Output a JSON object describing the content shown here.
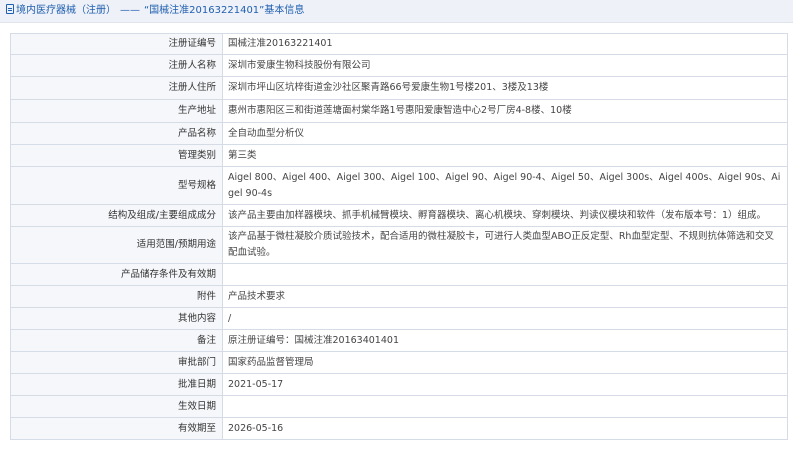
{
  "header": {
    "section": "境内医疗器械（注册）",
    "separator": "——",
    "title": "“国械注准20163221401”基本信息"
  },
  "rows": [
    {
      "label": "注册证编号",
      "value": "国械注准20163221401"
    },
    {
      "label": "注册人名称",
      "value": "深圳市爱康生物科技股份有限公司"
    },
    {
      "label": "注册人住所",
      "value": "深圳市坪山区坑梓街道金沙社区聚青路66号爱康生物1号楼201、3楼及13楼"
    },
    {
      "label": "生产地址",
      "value": "惠州市惠阳区三和街道莲塘面村棠华路1号惠阳爱康智造中心2号厂房4-8楼、10楼"
    },
    {
      "label": "产品名称",
      "value": "全自动血型分析仪"
    },
    {
      "label": "管理类别",
      "value": "第三类"
    },
    {
      "label": "型号规格",
      "value": "Aigel 800、Aigel 400、Aigel 300、Aigel 100、Aigel 90、Aigel 90-4、Aigel 50、Aigel 300s、Aigel 400s、Aigel 90s、Aigel 90-4s"
    },
    {
      "label": "结构及组成/主要组成成分",
      "value": "该产品主要由加样器模块、抓手机械臂模块、孵育器模块、离心机模块、穿刺模块、判读仪模块和软件（发布版本号：1）组成。"
    },
    {
      "label": "适用范围/预期用途",
      "value": "该产品基于微柱凝胶介质试验技术，配合适用的微柱凝胶卡，可进行人类血型ABO正反定型、Rh血型定型、不规则抗体筛选和交叉配血试验。"
    },
    {
      "label": "产品储存条件及有效期",
      "value": ""
    },
    {
      "label": "附件",
      "value": "产品技术要求"
    },
    {
      "label": "其他内容",
      "value": "/"
    },
    {
      "label": "备注",
      "value": "原注册证编号：国械注准20163401401"
    },
    {
      "label": "审批部门",
      "value": "国家药品监督管理局"
    },
    {
      "label": "批准日期",
      "value": "2021-05-17"
    },
    {
      "label": "生效日期",
      "value": ""
    },
    {
      "label": "有效期至",
      "value": "2026-05-16"
    }
  ]
}
